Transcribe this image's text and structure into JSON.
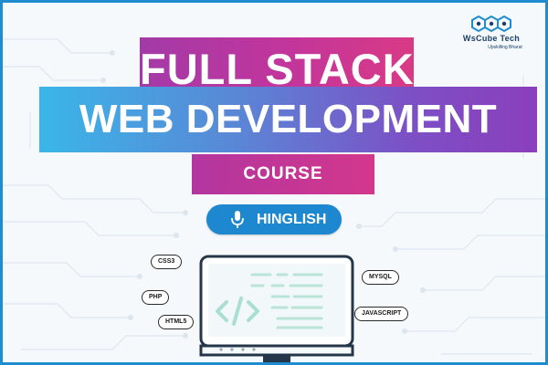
{
  "logo": {
    "brand": "WsCube Tech",
    "tagline": "Upskilling Bharat",
    "icon": "hexagon-cubes-icon"
  },
  "headline": {
    "line1": "FULL STACK",
    "line2": "WEB DEVELOPMENT",
    "line3": "COURSE"
  },
  "language": {
    "label": "HINGLISH",
    "icon": "microphone-icon"
  },
  "tech_tags": [
    "CSS3",
    "PHP",
    "HTML5",
    "MYSQL",
    "JAVASCRIPT"
  ],
  "colors": {
    "border": "#1f8ccf",
    "magenta": "#c3359b",
    "cyan": "#3ab6e8",
    "purple": "#7d4fc5",
    "pill": "#1d87cf",
    "code_glyph": "#a9dfcf"
  },
  "monitor": {
    "icon": "code-brackets-icon"
  }
}
